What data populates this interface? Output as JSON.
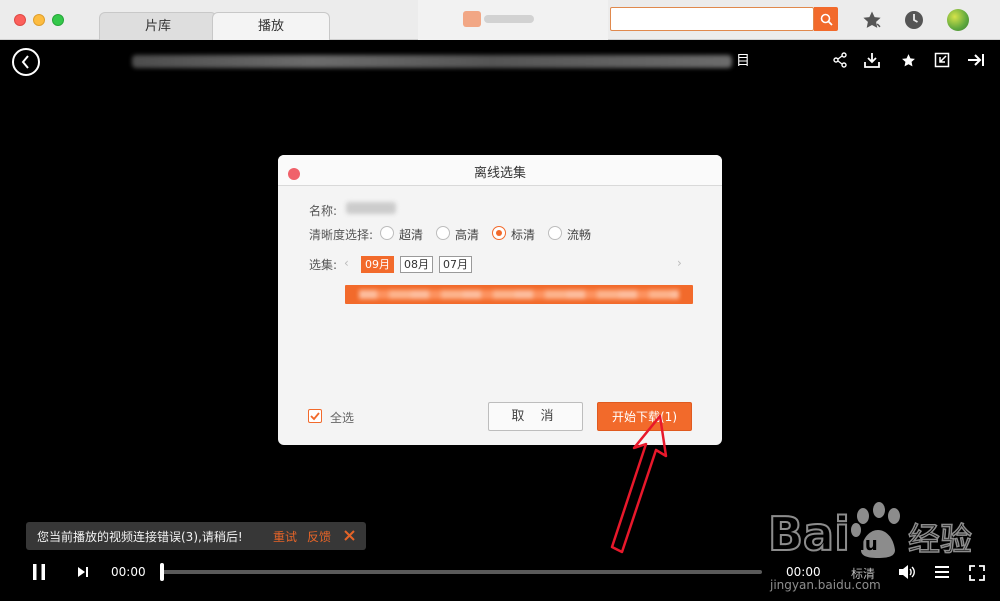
{
  "window": {
    "tabs": [
      {
        "label": "片库"
      },
      {
        "label": "播放"
      }
    ]
  },
  "search": {
    "placeholder": ""
  },
  "video": {
    "title_tail": "目"
  },
  "dialog": {
    "title": "离线选集",
    "name_label": "名称:",
    "quality_label": "清晰度选择:",
    "quality_options": [
      {
        "label": "超清",
        "selected": false
      },
      {
        "label": "高清",
        "selected": false
      },
      {
        "label": "标清",
        "selected": true
      },
      {
        "label": "流畅",
        "selected": false
      }
    ],
    "episodes_label": "选集:",
    "months": [
      {
        "label": "09月",
        "selected": true
      },
      {
        "label": "08月",
        "selected": false
      },
      {
        "label": "07月",
        "selected": false
      }
    ],
    "select_all_label": "全选",
    "select_all_checked": true,
    "cancel_label": "取 消",
    "start_label": "开始下载(1)"
  },
  "toast": {
    "message": "您当前播放的视频连接错误(3),请稍后!",
    "retry_label": "重试",
    "feedback_label": "反馈"
  },
  "player": {
    "current_time": "00:00",
    "duration": "00:00",
    "quality": "标清",
    "progress_fraction": 0
  },
  "watermark": {
    "text": "Baidu经验",
    "url": "jingyan.baidu.com"
  },
  "colors": {
    "accent": "#f26a2b",
    "background": "#000000",
    "annotation": "#e8182b"
  }
}
